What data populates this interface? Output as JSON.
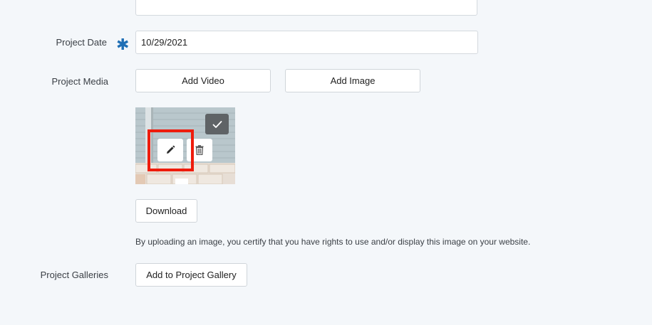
{
  "form": {
    "project_date": {
      "label": "Project Date",
      "required_mark": "✱",
      "value": "10/29/2021"
    },
    "project_media": {
      "label": "Project Media",
      "add_video_label": "Add Video",
      "add_image_label": "Add Image",
      "image_actions": {
        "select_icon": "check-icon",
        "edit_icon": "pencil-icon",
        "delete_icon": "trash-icon"
      },
      "download_label": "Download",
      "rights_note": "By uploading an image, you certify that you have rights to use and/or display this image on your website."
    },
    "project_galleries": {
      "label": "Project Galleries",
      "add_to_gallery_label": "Add to Project Gallery"
    }
  },
  "colors": {
    "page_background": "#f4f7fa",
    "required_accent": "#1f6fb5",
    "highlight_box": "#ee1c0c",
    "select_button": "#5f6366"
  }
}
